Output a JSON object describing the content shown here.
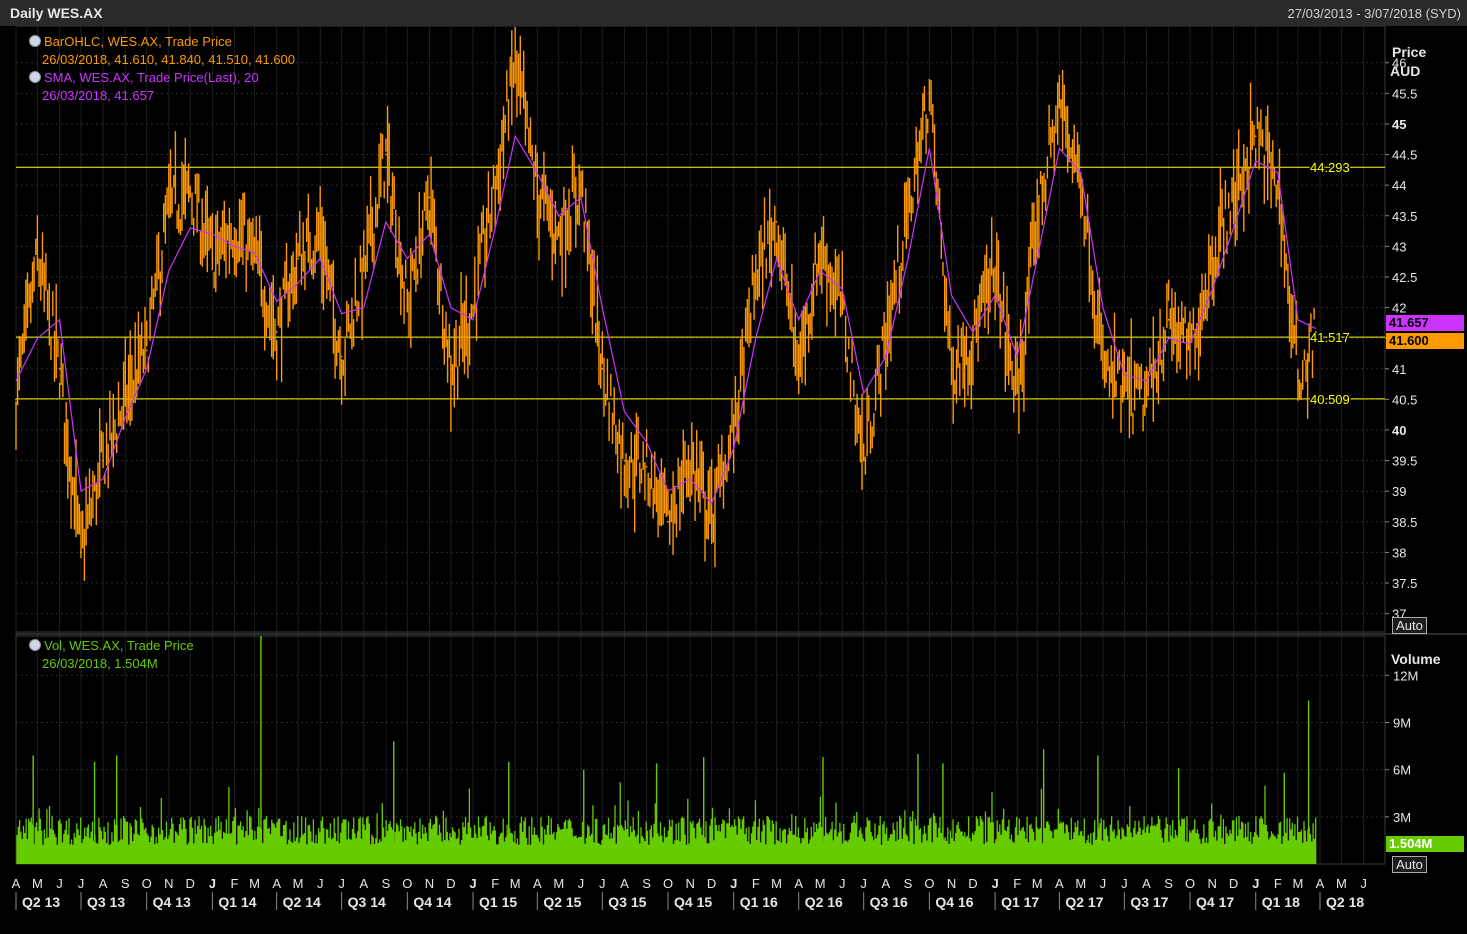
{
  "header": {
    "title": "Daily WES.AX",
    "date_range": "27/03/2013 - 3/07/2018 (SYD)"
  },
  "price_panel": {
    "axis_title_1": "Price",
    "axis_title_2": "AUD",
    "legend": [
      {
        "line1": "BarOHLC, WES.AX, Trade Price",
        "line2": "26/03/2018, 41.610, 41.840, 41.510, 41.600",
        "color": "#ff9900"
      },
      {
        "line1": "SMA, WES.AX, Trade Price(Last),  20",
        "line2": "26/03/2018, 41.657",
        "color": "#cc33ff"
      }
    ],
    "last_sma_tag": "41.657",
    "last_price_tag": "41.600",
    "auto_label": "Auto"
  },
  "volume_panel": {
    "axis_title": "Volume",
    "legend": {
      "line1": "Vol, WES.AX, Trade Price",
      "line2": "26/03/2018, 1.504M",
      "color": "#66cc00"
    },
    "last_volume_tag": "1.504M",
    "auto_label": "Auto"
  },
  "colors": {
    "background": "#000000",
    "price": "#ff9900",
    "sma": "#cc33ff",
    "volume": "#66cc00",
    "level_lines": "#ffff00",
    "grid": "#333333",
    "axis_text": "#e6e6e6"
  },
  "chart_data": [
    {
      "type": "line",
      "title": "BarOHLC, WES.AX, Trade Price",
      "ylabel": "Price AUD",
      "ylim": [
        36.7,
        46.6
      ],
      "y_ticks": [
        "37",
        "37.5",
        "38",
        "38.5",
        "39",
        "39.5",
        "40",
        "40.5",
        "41",
        "41.5",
        "42",
        "42.5",
        "43",
        "43.5",
        "44",
        "44.5",
        "45",
        "45.5",
        "46"
      ],
      "y_ticks_bold": [
        "40",
        "45"
      ],
      "grid": true,
      "x": [
        "2013-04-01",
        "2013-05-01",
        "2013-06-01",
        "2013-07-01",
        "2013-08-01",
        "2013-09-01",
        "2013-10-01",
        "2013-11-01",
        "2013-12-01",
        "2014-01-01",
        "2014-02-01",
        "2014-03-01",
        "2014-04-01",
        "2014-05-01",
        "2014-06-01",
        "2014-07-01",
        "2014-08-01",
        "2014-09-01",
        "2014-10-01",
        "2014-11-01",
        "2014-12-01",
        "2015-01-01",
        "2015-02-01",
        "2015-03-01",
        "2015-04-01",
        "2015-05-01",
        "2015-06-01",
        "2015-07-01",
        "2015-08-01",
        "2015-09-01",
        "2015-10-01",
        "2015-11-01",
        "2015-12-01",
        "2016-01-01",
        "2016-02-01",
        "2016-03-01",
        "2016-04-01",
        "2016-05-01",
        "2016-06-01",
        "2016-07-01",
        "2016-08-01",
        "2016-09-01",
        "2016-10-01",
        "2016-11-01",
        "2016-12-01",
        "2017-01-01",
        "2017-02-01",
        "2017-03-01",
        "2017-04-01",
        "2017-05-01",
        "2017-06-01",
        "2017-07-01",
        "2017-08-01",
        "2017-09-01",
        "2017-10-01",
        "2017-11-01",
        "2017-12-01",
        "2018-01-01",
        "2018-02-01",
        "2018-03-01",
        "2018-03-26"
      ],
      "series": [
        {
          "name": "BarOHLC, WES.AX, Trade Price",
          "color": "#ff9900",
          "values": [
            40.5,
            42.8,
            41.0,
            38.0,
            39.5,
            40.5,
            41.3,
            43.6,
            43.9,
            42.8,
            43.3,
            42.8,
            41.6,
            42.8,
            43.2,
            41.2,
            42.6,
            44.5,
            42.0,
            43.8,
            41.0,
            42.0,
            44.0,
            46.0,
            43.9,
            43.2,
            44.0,
            41.0,
            39.5,
            39.4,
            38.5,
            39.5,
            38.6,
            40.0,
            42.5,
            43.4,
            41.0,
            43.0,
            42.0,
            39.5,
            41.5,
            43.5,
            45.5,
            41.0,
            41.5,
            42.6,
            40.5,
            43.5,
            45.3,
            44.2,
            41.0,
            40.6,
            40.5,
            41.8,
            41.3,
            42.8,
            43.8,
            44.8,
            44.0,
            40.8,
            41.6
          ]
        },
        {
          "name": "SMA, WES.AX, Trade Price(Last),  20",
          "color": "#cc33ff",
          "values": [
            40.8,
            41.5,
            41.8,
            39.0,
            39.2,
            40.2,
            41.0,
            42.6,
            43.3,
            43.2,
            43.0,
            42.9,
            42.1,
            42.4,
            42.8,
            41.9,
            42.0,
            43.4,
            42.8,
            43.2,
            42.0,
            41.8,
            43.3,
            44.8,
            44.2,
            43.5,
            43.8,
            42.0,
            40.3,
            39.8,
            39.0,
            39.2,
            38.8,
            39.7,
            41.5,
            42.8,
            41.8,
            42.6,
            42.3,
            40.6,
            41.2,
            42.8,
            44.6,
            42.2,
            41.6,
            42.2,
            41.2,
            42.8,
            44.6,
            44.2,
            42.0,
            40.9,
            40.8,
            41.5,
            41.4,
            42.3,
            43.3,
            44.4,
            44.2,
            41.8,
            41.657
          ]
        }
      ],
      "levels": [
        44.293,
        41.517,
        40.509
      ]
    },
    {
      "type": "bar",
      "title": "Vol, WES.AX, Trade Price",
      "ylabel": "Volume",
      "ylim": [
        0,
        14.5
      ],
      "y_ticks": [
        "3M",
        "6M",
        "9M",
        "12M"
      ],
      "x_ticks": [
        "A",
        "M",
        "J",
        "J",
        "A",
        "S",
        "O",
        "N",
        "D",
        "J",
        "F",
        "M",
        "A",
        "M",
        "J",
        "J",
        "A",
        "S",
        "O",
        "N",
        "D",
        "J",
        "F",
        "M",
        "A",
        "M",
        "J",
        "J",
        "A",
        "S",
        "O",
        "N",
        "D",
        "J",
        "F",
        "M",
        "A",
        "M",
        "J",
        "J",
        "A",
        "S",
        "O",
        "N",
        "D",
        "J",
        "F",
        "M",
        "A",
        "M",
        "J",
        "J",
        "A",
        "S",
        "O",
        "N",
        "D",
        "J",
        "F",
        "M",
        "A",
        "M",
        "J"
      ],
      "x_ticks_bold": [
        "J",
        "J",
        "J",
        "J",
        "J",
        "J"
      ],
      "quarters": [
        "Q2 13",
        "Q3 13",
        "Q4 13",
        "Q1 14",
        "Q2 14",
        "Q3 14",
        "Q4 14",
        "Q1 15",
        "Q2 15",
        "Q3 15",
        "Q4 15",
        "Q1 16",
        "Q2 16",
        "Q3 16",
        "Q4 16",
        "Q1 17",
        "Q2 17",
        "Q3 17",
        "Q4 17",
        "Q1 18",
        "Q2 18"
      ],
      "series": [
        {
          "name": "Vol, WES.AX, Trade Price",
          "color": "#66cc00",
          "typical_millions": 2.2,
          "spikes": [
            {
              "x": "2013-04-25",
              "value": 6.9
            },
            {
              "x": "2013-07-20",
              "value": 6.5
            },
            {
              "x": "2013-08-20",
              "value": 6.9
            },
            {
              "x": "2014-03-10",
              "value": 15.3
            },
            {
              "x": "2014-09-12",
              "value": 7.8
            },
            {
              "x": "2015-02-20",
              "value": 6.5
            },
            {
              "x": "2015-06-05",
              "value": 6.0
            },
            {
              "x": "2015-09-15",
              "value": 6.4
            },
            {
              "x": "2015-11-20",
              "value": 6.8
            },
            {
              "x": "2016-05-05",
              "value": 6.8
            },
            {
              "x": "2016-09-15",
              "value": 7.0
            },
            {
              "x": "2016-10-20",
              "value": 6.4
            },
            {
              "x": "2017-03-10",
              "value": 7.3
            },
            {
              "x": "2017-05-25",
              "value": 6.9
            },
            {
              "x": "2017-09-15",
              "value": 6.1
            },
            {
              "x": "2018-02-10",
              "value": 5.8
            },
            {
              "x": "2018-03-16",
              "value": 10.4
            }
          ],
          "last_value": 1.504
        }
      ]
    }
  ]
}
